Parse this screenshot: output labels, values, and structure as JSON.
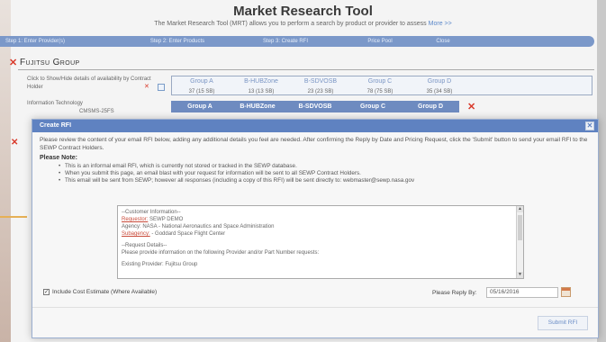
{
  "app": {
    "title": "Market Research Tool",
    "subtitle": "The Market Research Tool (MRT) allows you to perform a search by product or provider to assess",
    "more_link": "More >>"
  },
  "steps": [
    "Step 1: Enter Provider(s)",
    "Step 2: Enter Products",
    "Step 3: Create RFI",
    "Price Pool",
    "Close"
  ],
  "provider": {
    "name": "Fujitsu Group",
    "click_info": "Click to Show/Hide details of availability by Contract Holder",
    "groups": [
      "Group A",
      "B-HUBZone",
      "B-SDVOSB",
      "Group C",
      "Group D"
    ],
    "counts": [
      "37 (15 SB)",
      "13 (13 SB)",
      "23 (23 SB)",
      "78 (75 SB)",
      "35 (34 SB)"
    ],
    "it_label": "Information Technology",
    "it_sub": "CMSMS-25FS"
  },
  "modal": {
    "title": "Create RFI",
    "intro": "Please review the content of your email RFI below, adding any additional details you feel are needed. After confirming the Reply by Date and Pricing Request, click the 'Submit' button to send your email RFI to the SEWP Contract Holders.",
    "note_title": "Please Note:",
    "notes": [
      "This is an informal email RFI, which is currently not stored or tracked in the SEWP database.",
      "When you submit this page, an email blast with your request for information will be sent to all SEWP Contract Holders.",
      "This email will be sent from SEWP; however all responses (including a copy of this RFI) will be sent directly to: webmaster@sewp.nasa.gov"
    ],
    "email": {
      "customer_header": "--Customer Information--",
      "requestor_key": "Requestor:",
      "requestor_val": "SEWP DEMO",
      "agency": "Agency: NASA - National Aeronautics and Space Administration",
      "subagency_key": "Subagency:",
      "subagency_val": "- Goddard Space Flight Center",
      "request_header": "--Request Details--",
      "request_text": "Please provide information on the following Provider and/or Part Number requests:",
      "existing_provider": "Existing Provider: Fujitsu Group"
    },
    "cost_label": "Include Cost Estimate (Where Available)",
    "reply_label": "Please Reply By:",
    "reply_date": "05/16/2016",
    "submit_label": "Submit RFI"
  }
}
